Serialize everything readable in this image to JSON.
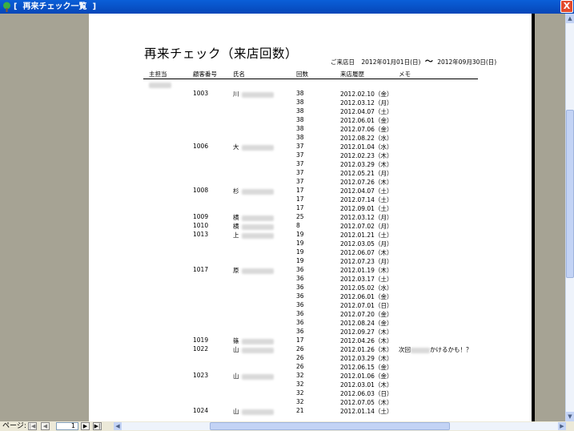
{
  "window": {
    "title": "[  再来チェック一覧  ]",
    "close_label": "X"
  },
  "report": {
    "title": "再来チェック（来店回数）",
    "period_label": "ご来店日",
    "period_from": "2012年01月01日(日)",
    "period_sep": "〜",
    "period_to": "2012年09月30日(日)",
    "headers": {
      "staff": "主担当",
      "customer_no": "顧客番号",
      "name": "氏名",
      "count": "回数",
      "history": "来店履歴",
      "memo": "メモ"
    },
    "staff_name": "鈴木 誠",
    "rows": [
      {
        "no": "1003",
        "name": "川",
        "count": "38",
        "date": "2012.02.10（金）",
        "memo": ""
      },
      {
        "no": "",
        "name": "",
        "count": "38",
        "date": "2012.03.12（月）",
        "memo": ""
      },
      {
        "no": "",
        "name": "",
        "count": "38",
        "date": "2012.04.07（土）",
        "memo": ""
      },
      {
        "no": "",
        "name": "",
        "count": "38",
        "date": "2012.06.01（金）",
        "memo": ""
      },
      {
        "no": "",
        "name": "",
        "count": "38",
        "date": "2012.07.06（金）",
        "memo": ""
      },
      {
        "no": "",
        "name": "",
        "count": "38",
        "date": "2012.08.22（水）",
        "memo": ""
      },
      {
        "no": "1006",
        "name": "大",
        "count": "37",
        "date": "2012.01.04（水）",
        "memo": ""
      },
      {
        "no": "",
        "name": "",
        "count": "37",
        "date": "2012.02.23（木）",
        "memo": ""
      },
      {
        "no": "",
        "name": "",
        "count": "37",
        "date": "2012.03.29（木）",
        "memo": ""
      },
      {
        "no": "",
        "name": "",
        "count": "37",
        "date": "2012.05.21（月）",
        "memo": ""
      },
      {
        "no": "",
        "name": "",
        "count": "37",
        "date": "2012.07.26（木）",
        "memo": ""
      },
      {
        "no": "1008",
        "name": "杉",
        "count": "17",
        "date": "2012.04.07（土）",
        "memo": ""
      },
      {
        "no": "",
        "name": "",
        "count": "17",
        "date": "2012.07.14（土）",
        "memo": ""
      },
      {
        "no": "",
        "name": "",
        "count": "17",
        "date": "2012.09.01（土）",
        "memo": ""
      },
      {
        "no": "1009",
        "name": "横",
        "count": "25",
        "date": "2012.03.12（月）",
        "memo": ""
      },
      {
        "no": "1010",
        "name": "横",
        "count": "8",
        "date": "2012.07.02（月）",
        "memo": ""
      },
      {
        "no": "1013",
        "name": "上",
        "count": "19",
        "date": "2012.01.21（土）",
        "memo": ""
      },
      {
        "no": "",
        "name": "",
        "count": "19",
        "date": "2012.03.05（月）",
        "memo": ""
      },
      {
        "no": "",
        "name": "",
        "count": "19",
        "date": "2012.06.07（木）",
        "memo": ""
      },
      {
        "no": "",
        "name": "",
        "count": "19",
        "date": "2012.07.23（月）",
        "memo": ""
      },
      {
        "no": "1017",
        "name": "原",
        "count": "36",
        "date": "2012.01.19（木）",
        "memo": ""
      },
      {
        "no": "",
        "name": "",
        "count": "36",
        "date": "2012.03.17（土）",
        "memo": ""
      },
      {
        "no": "",
        "name": "",
        "count": "36",
        "date": "2012.05.02（水）",
        "memo": ""
      },
      {
        "no": "",
        "name": "",
        "count": "36",
        "date": "2012.06.01（金）",
        "memo": ""
      },
      {
        "no": "",
        "name": "",
        "count": "36",
        "date": "2012.07.01（日）",
        "memo": ""
      },
      {
        "no": "",
        "name": "",
        "count": "36",
        "date": "2012.07.20（金）",
        "memo": ""
      },
      {
        "no": "",
        "name": "",
        "count": "36",
        "date": "2012.08.24（金）",
        "memo": ""
      },
      {
        "no": "",
        "name": "",
        "count": "36",
        "date": "2012.09.27（木）",
        "memo": ""
      },
      {
        "no": "1019",
        "name": "篠",
        "count": "17",
        "date": "2012.04.26（木）",
        "memo": ""
      },
      {
        "no": "1022",
        "name": "山",
        "count": "26",
        "date": "2012.01.26（木）",
        "memo": "次回"
      },
      {
        "no": "",
        "name": "",
        "count": "26",
        "date": "2012.03.29（木）",
        "memo": ""
      },
      {
        "no": "",
        "name": "",
        "count": "26",
        "date": "2012.06.15（金）",
        "memo": ""
      },
      {
        "no": "1023",
        "name": "山",
        "count": "32",
        "date": "2012.01.06（金）",
        "memo": ""
      },
      {
        "no": "",
        "name": "",
        "count": "32",
        "date": "2012.03.01（木）",
        "memo": ""
      },
      {
        "no": "",
        "name": "",
        "count": "32",
        "date": "2012.06.03（日）",
        "memo": ""
      },
      {
        "no": "",
        "name": "",
        "count": "32",
        "date": "2012.07.05（木）",
        "memo": ""
      },
      {
        "no": "1024",
        "name": "山",
        "count": "21",
        "date": "2012.01.14（土）",
        "memo": ""
      }
    ]
  },
  "memo_tail": "かけるかも！？",
  "statusbar": {
    "page_label": "ページ:",
    "page_value": "1"
  }
}
